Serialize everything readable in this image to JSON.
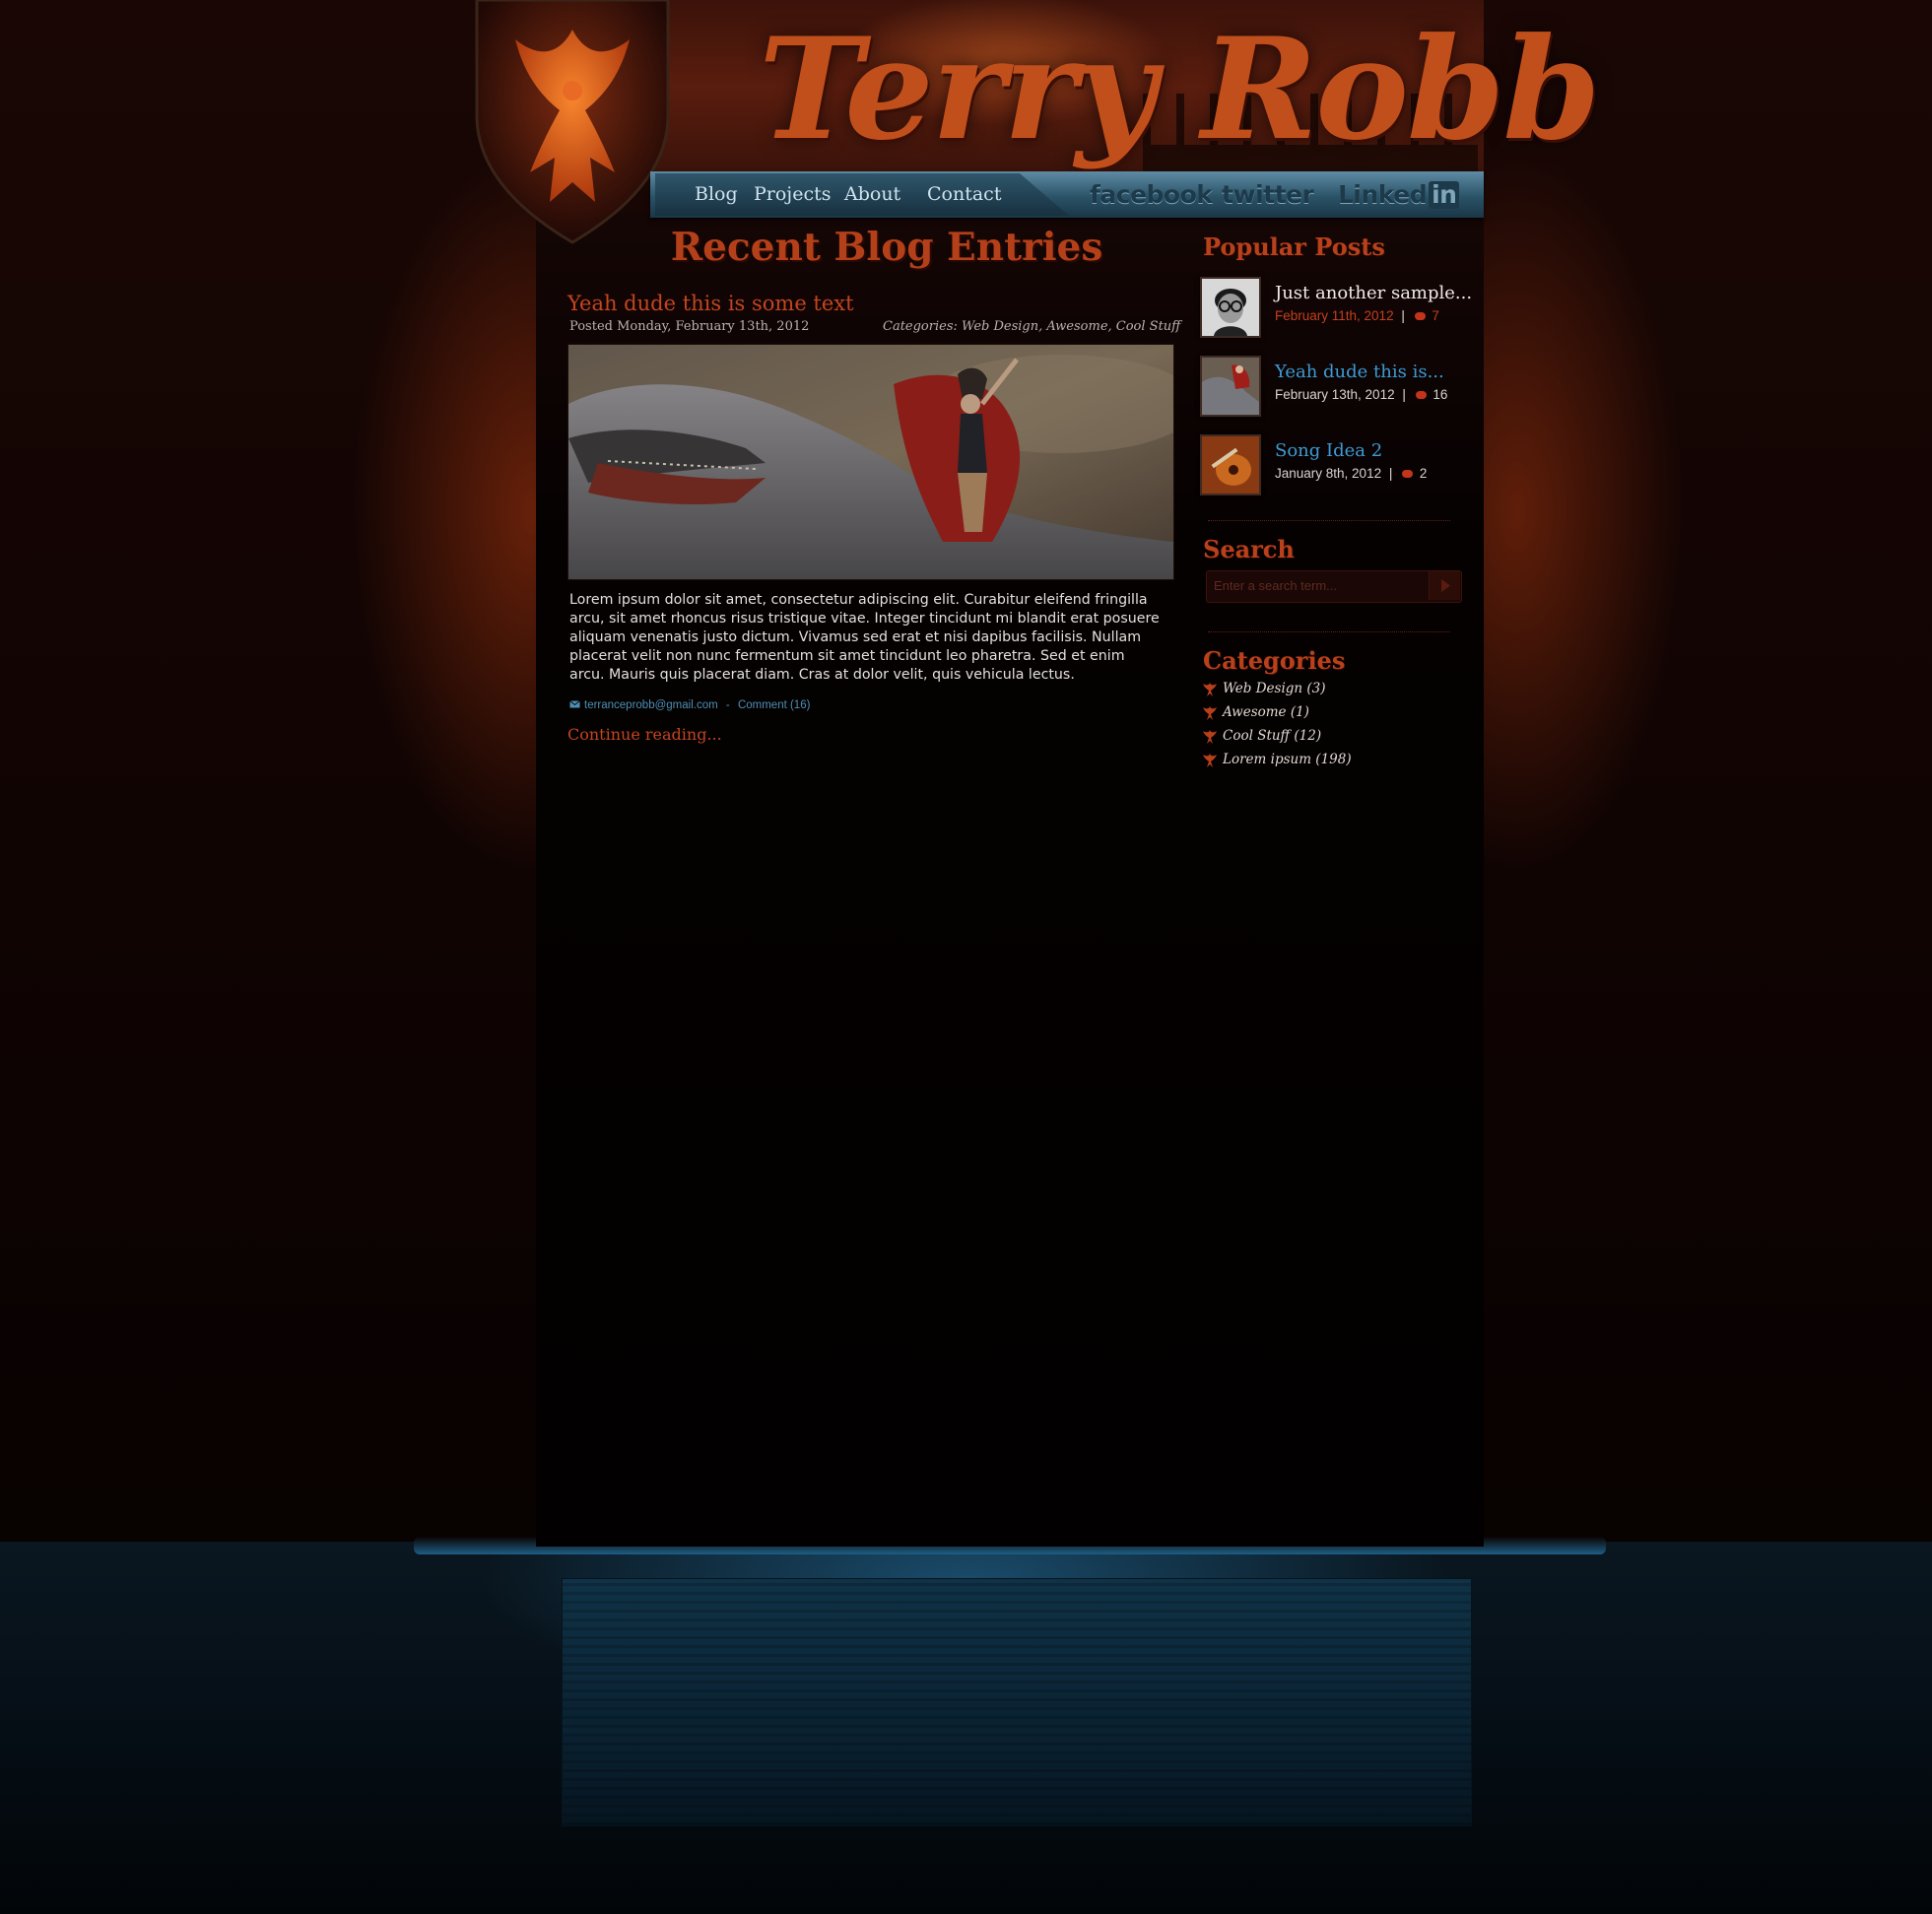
{
  "header": {
    "site_title": "Terry Robb"
  },
  "nav": {
    "items": [
      {
        "label": "Blog"
      },
      {
        "label": "Projects"
      },
      {
        "label": "About"
      },
      {
        "label": "Contact"
      }
    ]
  },
  "social": {
    "facebook": "facebook",
    "twitter": "twitter",
    "linkedin_text": "Linked",
    "linkedin_in": "in"
  },
  "main": {
    "section_title": "Recent Blog Entries",
    "post": {
      "title": "Yeah dude this is some text",
      "posted": "Posted Monday, February 13th, 2012",
      "categories": "Categories: Web Design, Awesome, Cool Stuff",
      "body": "Lorem ipsum dolor sit amet, consectetur adipiscing elit. Curabitur eleifend fringilla arcu, sit amet rhoncus risus tristique vitae. Integer tincidunt mi blandit erat posuere aliquam venenatis justo dictum. Vivamus sed erat et nisi dapibus facilisis. Nullam placerat velit non nunc fermentum sit amet tincidunt leo pharetra. Sed et enim arcu. Mauris quis placerat diam. Cras at dolor velit, quis vehicula lectus.",
      "email": "terranceprobb@gmail.com",
      "separator": "-",
      "comment_link": "Comment (16)",
      "continue": "Continue reading..."
    }
  },
  "sidebar": {
    "popular_heading": "Popular Posts",
    "popular": [
      {
        "title": "Just another sample...",
        "date": "February 11th, 2012",
        "sep": "|",
        "comments": "7",
        "title_color": "#f1ece8",
        "date_color": "#c3401c",
        "count_color": "#c3401c"
      },
      {
        "title": "Yeah dude this is...",
        "date": "February 13th, 2012",
        "sep": "|",
        "comments": "16",
        "title_color": "#3d9bd4",
        "date_color": "#d8d4d0",
        "count_color": "#d8d4d0"
      },
      {
        "title": "Song Idea 2",
        "date": "January 8th, 2012",
        "sep": "|",
        "comments": "2",
        "title_color": "#3d9bd4",
        "date_color": "#d8d4d0",
        "count_color": "#d8d4d0"
      }
    ],
    "search_heading": "Search",
    "search_placeholder": "Enter a search term...",
    "categories_heading": "Categories",
    "categories": [
      {
        "label": "Web Design (3)"
      },
      {
        "label": "Awesome (1)"
      },
      {
        "label": "Cool Stuff (12)"
      },
      {
        "label": "Lorem ipsum (198)"
      }
    ]
  },
  "colors": {
    "accent_red": "#c4451f",
    "link_blue": "#3d9bd4",
    "nav_blue": "#2b5368"
  },
  "icons": {
    "shield": "phoenix-shield-icon",
    "mail": "mail-icon",
    "comment": "comment-bubble-icon",
    "search_submit": "play-arrow-icon",
    "category_bullet": "phoenix-bullet-icon"
  }
}
